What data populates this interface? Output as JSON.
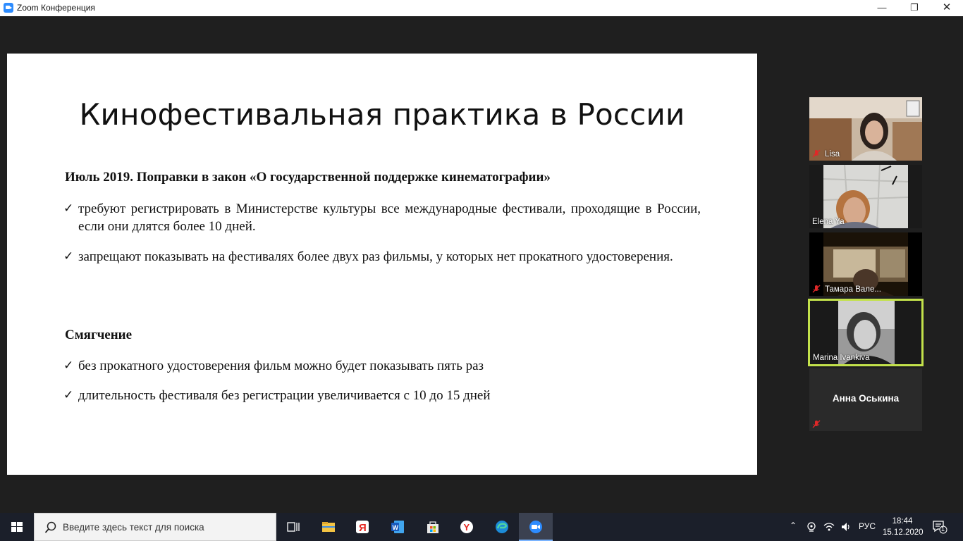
{
  "window": {
    "title": "Zoom Конференция",
    "min_glyph": "—",
    "max_glyph": "❐",
    "close_glyph": "✕"
  },
  "slide": {
    "title": "Кинофестивальная практика в России",
    "heading1": "Июль 2019. Поправки в закон «О государственной поддержке кинематографии»",
    "bullets1": [
      "требуют регистрировать в Министерстве культуры все международные фестивали, проходящие в России, если они длятся более 10 дней.",
      "запрещают показывать на фестивалях более двух раз фильмы, у которых нет прокатного удостоверения."
    ],
    "heading2": "Смягчение",
    "bullets2": [
      "без прокатного удостоверения фильм можно будет показывать пять раз",
      "длительность фестиваля без регистрации увеличивается с 10 до 15 дней"
    ],
    "check_glyph": "✓"
  },
  "participants": [
    {
      "name": "Lisa",
      "muted": true,
      "video": true
    },
    {
      "name": "Elena Ya",
      "muted": false,
      "video": true
    },
    {
      "name": "Тамара Вале...",
      "muted": true,
      "video": true
    },
    {
      "name": "Marina Ivankiva",
      "muted": false,
      "video": true,
      "active_speaker": true,
      "highlight_color": "#c3e24b"
    },
    {
      "name": "Анна Оськина",
      "muted": true,
      "video": false
    }
  ],
  "taskbar": {
    "search_placeholder": "Введите здесь текст для поиска",
    "apps": [
      "task-view",
      "file-explorer",
      "yandex",
      "word",
      "store",
      "yandex-browser",
      "edge",
      "zoom"
    ],
    "language": "РУС",
    "time": "18:44",
    "date": "15.12.2020",
    "notification_count": "1"
  }
}
